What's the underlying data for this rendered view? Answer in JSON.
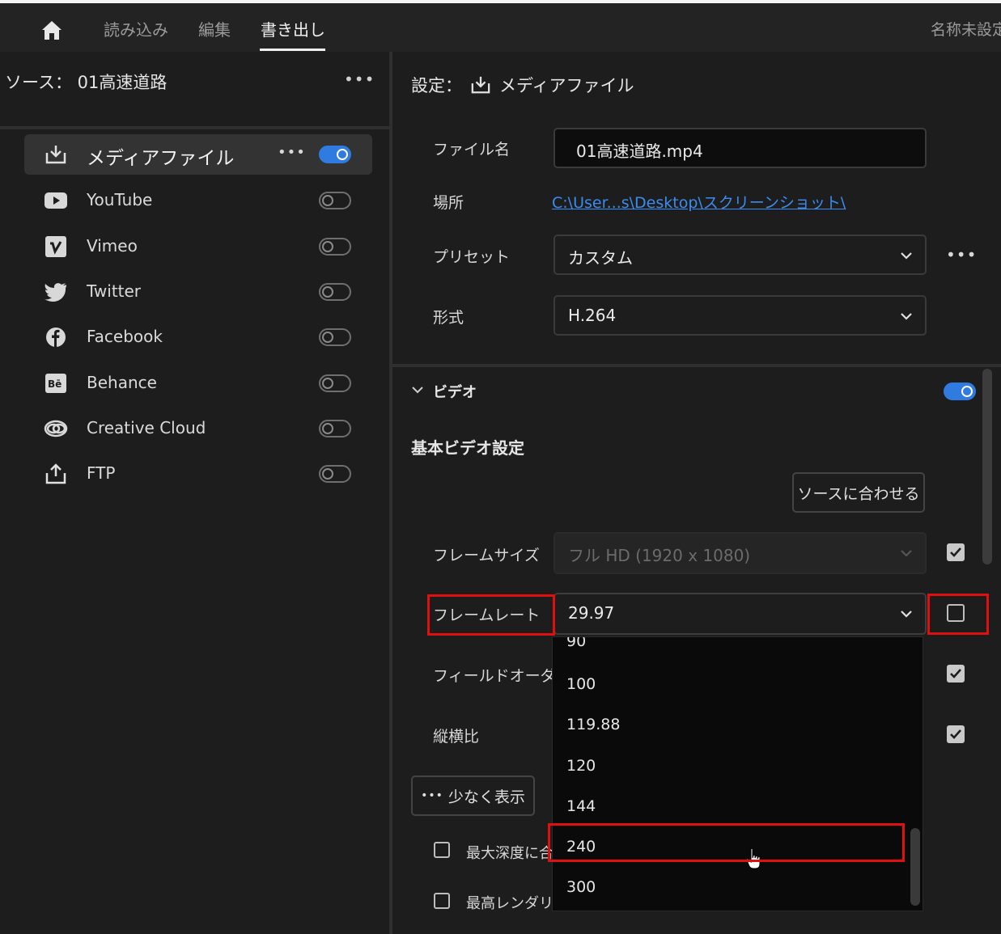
{
  "topbar": {
    "tabs": [
      "読み込み",
      "編集",
      "書き出し"
    ],
    "active_tab": "書き出し",
    "project_title": "名称未設定"
  },
  "source": {
    "label": "ソース：",
    "name": "01高速道路"
  },
  "destinations": [
    {
      "label": "メディアファイル",
      "icon": "download-icon",
      "enabled": true,
      "selected": true
    },
    {
      "label": "YouTube",
      "icon": "youtube-icon",
      "enabled": false
    },
    {
      "label": "Vimeo",
      "icon": "vimeo-icon",
      "enabled": false
    },
    {
      "label": "Twitter",
      "icon": "twitter-icon",
      "enabled": false
    },
    {
      "label": "Facebook",
      "icon": "facebook-icon",
      "enabled": false
    },
    {
      "label": "Behance",
      "icon": "behance-icon",
      "enabled": false
    },
    {
      "label": "Creative Cloud",
      "icon": "creative-cloud-icon",
      "enabled": false
    },
    {
      "label": "FTP",
      "icon": "upload-icon",
      "enabled": false
    }
  ],
  "settings": {
    "title_prefix": "設定：",
    "title": "メディアファイル",
    "filename_label": "ファイル名",
    "filename": "01高速道路.mp4",
    "location_label": "場所",
    "location": "C:\\User...s\\Desktop\\スクリーンショット\\",
    "preset_label": "プリセット",
    "preset": "カスタム",
    "format_label": "形式",
    "format": "H.264"
  },
  "video": {
    "section_label": "ビデオ",
    "enabled": true,
    "basic_label": "基本ビデオ設定",
    "match_source_button": "ソースに合わせる",
    "frame_size_label": "フレームサイズ",
    "frame_size": "フル HD (1920 x 1080)",
    "frame_size_match": true,
    "frame_rate_label": "フレームレート",
    "frame_rate": "29.97",
    "frame_rate_match": false,
    "field_order_label": "フィールドオーダー",
    "field_order_match": true,
    "aspect_label": "縦横比",
    "aspect_match": true,
    "show_less_button": "少なく表示",
    "max_depth_label": "最大深度に合",
    "max_render_label": "最高レンダリン"
  },
  "frame_rate_options": [
    "90",
    "100",
    "119.88",
    "120",
    "144",
    "240",
    "300"
  ],
  "hovered_option": "240",
  "colors": {
    "accent": "#2f7bdf",
    "link": "#3b8cf0",
    "highlight": "#e01010"
  }
}
